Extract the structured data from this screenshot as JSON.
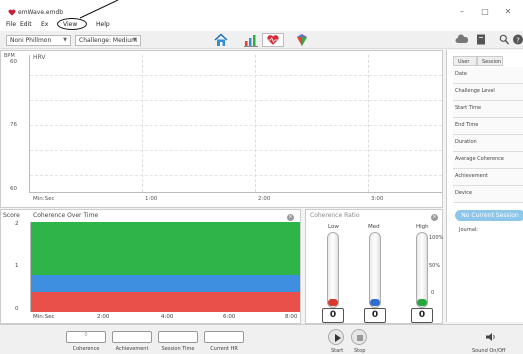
{
  "window": {
    "title": "emWave.emdb",
    "controls": {
      "minimize": "–",
      "maximize": "□",
      "close": "✕"
    }
  },
  "menu": {
    "file": "File",
    "edit": "Edit",
    "ext": "Ex",
    "view": "View",
    "help": "Help"
  },
  "toolbar": {
    "user": "Noni Phillmon",
    "challenge": "Challenge: Medium",
    "icons": [
      "home-icon",
      "bar-chart-icon",
      "heart-monitor-icon",
      "gem-icon",
      "cloud-icon",
      "journal-icon",
      "search-icon",
      "help-icon"
    ]
  },
  "hrv": {
    "title": "HRV",
    "bpm_label": "BPM",
    "y_ticks": [
      "60",
      "76",
      "60"
    ],
    "x_ticks": [
      "Min:Sec",
      "1:00",
      "2:00",
      "3:00"
    ]
  },
  "sidebar": {
    "tabs": [
      "User",
      "Session"
    ],
    "fields": [
      "Date",
      "Challenge Level",
      "Start Time",
      "End Time",
      "Duration",
      "Average Coherence",
      "Achievement",
      "Device"
    ],
    "no_session": "No Current Session",
    "journal": "Journal:"
  },
  "coherence_time": {
    "score_label": "Score",
    "title": "Coherence Over Time",
    "y_ticks": [
      "2",
      "1",
      "0"
    ],
    "x_ticks": [
      "Min:Sec",
      "2:00",
      "4:00",
      "6:00",
      "8:00"
    ],
    "colors": {
      "high": "#2db54a",
      "medium": "#3f8fe0",
      "low": "#e8504a"
    }
  },
  "coherence_ratio": {
    "title": "Coherence Ratio",
    "columns": [
      "Low",
      "Med",
      "High"
    ],
    "scale": [
      "100%",
      "50%",
      "0"
    ],
    "values": [
      "0",
      "0",
      "0"
    ],
    "colors": {
      "low": "#d9382f",
      "med": "#2f6fd0",
      "high": "#24a83c"
    }
  },
  "bottom": {
    "stat_labels": [
      "Coherence",
      "Achievement",
      "Session Time",
      "Current HR"
    ],
    "coherence_value": "0",
    "start": "Start",
    "stop": "Stop",
    "sound": "Sound On/Off"
  }
}
